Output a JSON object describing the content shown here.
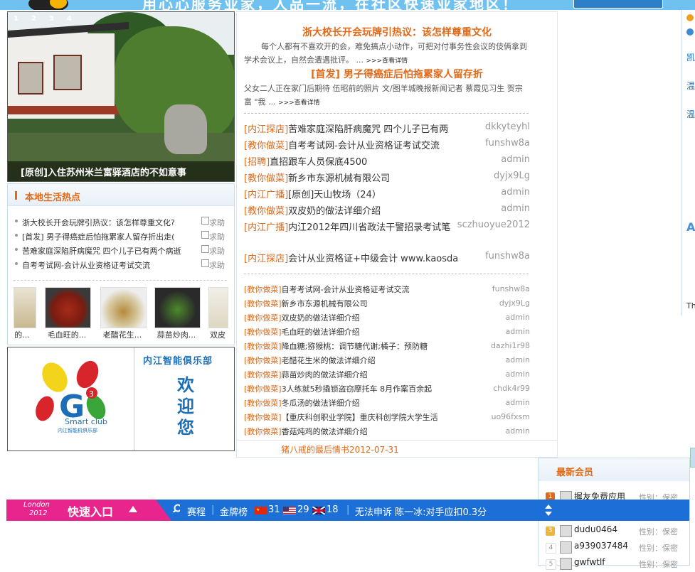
{
  "slider": {
    "caption": "[原创]入住苏州米兰富驿酒店的不如意事",
    "dots": "1234"
  },
  "local_hot": {
    "title": "本地生活热点",
    "items": [
      {
        "title": "浙大校长开会玩牌引热议：该怎样尊重文化?"
      },
      {
        "title": "[首发] 男子得癌症后怕拖累家人留存折出走("
      },
      {
        "title": "苦难家庭深陷肝病魔咒 四个儿子已有两个病逝"
      },
      {
        "title": "自考考试网-会计从业资格证考试交流"
      }
    ],
    "ask_label": "求助",
    "thumbs": [
      {
        "label": "的..."
      },
      {
        "label": "毛血旺的..."
      },
      {
        "label": "老醋花生..."
      },
      {
        "label": "蒜苗炒肉..."
      },
      {
        "label": "双皮"
      }
    ]
  },
  "club": {
    "name": "内江智能俱乐部",
    "welcome": "欢迎您",
    "smart": "Smart club",
    "smart_cn": "内江智能机俱乐部",
    "logo_digit": "3"
  },
  "center": {
    "headlines": [
      {
        "title": "浙大校长开会玩牌引热议：该怎样尊重文化",
        "summary": "每个人都有不喜欢开的会，难免搞点小动作，可把对付事务性会议的伎俩拿到学术会议上，自然会遭遇批评。 ... ",
        "more": ">>>查看详情"
      },
      {
        "title": "[首发] 男子得癌症后怕拖累家人留存折",
        "summary": "父女二人正在家门后期待 伍昭前的照片 文/图羊城晚报新闻记者 蔡霞见习生 贺宗富 \"我 ... ",
        "more": ">>>查看详情"
      }
    ],
    "list_a": [
      {
        "cat": "[内江探店]",
        "title": "苦难家庭深陷肝病魔咒 四个儿子已有两",
        "author": "dkkyteyhl"
      },
      {
        "cat": "[教你做菜]",
        "title": "自考考试网-会计从业资格证考试交流",
        "author": "funshw8a"
      },
      {
        "cat": "[招聘]",
        "title": "直招跟车人员保底4500",
        "author": "admin"
      },
      {
        "cat": "[教你做菜]",
        "title": "新乡市东源机械有限公司",
        "author": "dyjx9Lg"
      },
      {
        "cat": "[内江广播]",
        "title": "[原创]天山牧场（24）",
        "author": "admin"
      },
      {
        "cat": "[教你做菜]",
        "title": "双皮奶的做法详细介绍",
        "author": "admin"
      },
      {
        "cat": "[内江广播]",
        "title": "内江2012年四川省政法干警招录考试笔",
        "author": "sczhuoyue2012"
      },
      {
        "cat": "[内江探店]",
        "title": "会计从业资格证+中级会计 www.kaosda",
        "author": "funshw8a"
      }
    ],
    "list_b": [
      {
        "cat": "[教你做菜]",
        "title": "自考考试网-会计从业资格证考试交流",
        "author": "funshw8a"
      },
      {
        "cat": "[教你做菜]",
        "title": "新乡市东源机械有限公司",
        "author": "dyjx9Lg"
      },
      {
        "cat": "[教你做菜]",
        "title": "双皮奶的做法详细介绍",
        "author": "admin"
      },
      {
        "cat": "[教你做菜]",
        "title": "毛血旺的做法详细介绍",
        "author": "admin"
      },
      {
        "cat": "[教你做菜]",
        "title": "降血糖;猕猴桃：调节糖代谢;橘子：预防糖",
        "author": "dazhi1r98"
      },
      {
        "cat": "[教你做菜]",
        "title": "老醋花生米的做法详细介绍",
        "author": "admin"
      },
      {
        "cat": "[教你做菜]",
        "title": "蒜苗炒肉的做法详细介绍",
        "author": "admin"
      },
      {
        "cat": "[教你做菜]",
        "title": "3人练就5秒撬锁盗窃摩托车 8月作案百余起",
        "author": "chdk4r99"
      },
      {
        "cat": "[教你做菜]",
        "title": "冬瓜汤的做法详细介绍",
        "author": "admin"
      },
      {
        "cat": "[教你做菜]",
        "title": "【重庆科创职业学院】重庆科创学院大学生活",
        "author": "uo96fxsm"
      },
      {
        "cat": "[教你做菜]",
        "title": "香菇炖鸡的做法详细介绍",
        "author": "admin"
      }
    ],
    "footer": "猪八戒的最后情书2012-07-31"
  },
  "london": {
    "logo_line1": "London",
    "logo_line2": "2012",
    "quick": "快速入口",
    "schedule": "赛程",
    "medal": "金牌榜",
    "cn_count": "31",
    "us_count": "29",
    "gb_count": "18",
    "ticker": "无法申诉 陈一冰:对手应扣0.3分"
  },
  "members": {
    "title": "最新会员",
    "gender_label": "性别：保密",
    "list": [
      {
        "rank": "1",
        "name": "握友免费应用"
      },
      {
        "rank": "2",
        "name": ""
      },
      {
        "rank": "3",
        "name": "dudu0464"
      },
      {
        "rank": "4",
        "name": "a939037484"
      },
      {
        "rank": "5",
        "name": "gwfwtlf"
      }
    ]
  },
  "right_col": {
    "items": [
      "凯",
      "温",
      "温",
      "A",
      "Th"
    ]
  },
  "top": {
    "slogan": "用心心服务业家，人品一流，在社区快速业家地区！"
  },
  "colors": {
    "accent": "#e06a1a",
    "brand_blue": "#1c6fd6",
    "london_pink": "#e8258d"
  }
}
